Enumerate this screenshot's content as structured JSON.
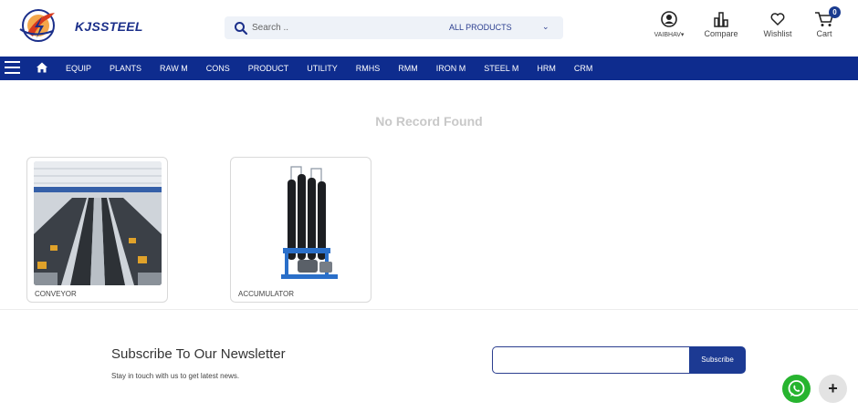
{
  "header": {
    "logo_text": "KJSSTEEL",
    "search": {
      "placeholder": "Search ..",
      "category": "ALL PRODUCTS"
    },
    "user": {
      "label": "VAIBHAV"
    },
    "compare": {
      "label": "Compare"
    },
    "wishlist": {
      "label": "Wishlist"
    },
    "cart": {
      "label": "Cart",
      "count": "0"
    }
  },
  "nav": {
    "items": [
      "EQUIP",
      "PLANTS",
      "RAW M",
      "CONS",
      "PRODUCT",
      "UTILITY",
      "RMHS",
      "RMM",
      "IRON M",
      "STEEL M",
      "HRM",
      "CRM"
    ]
  },
  "main": {
    "empty_message": "No Record Found",
    "products": [
      {
        "label": "CONVEYOR"
      },
      {
        "label": "ACCUMULATOR"
      }
    ]
  },
  "newsletter": {
    "title": "Subscribe To Our Newsletter",
    "subtitle": "Stay in touch with us to get latest news.",
    "button": "Subscribe"
  },
  "floating": {
    "plus": "+"
  },
  "colors": {
    "brand": "#0e2c8e",
    "accent": "#f05a28",
    "whatsapp": "#27b42f"
  }
}
